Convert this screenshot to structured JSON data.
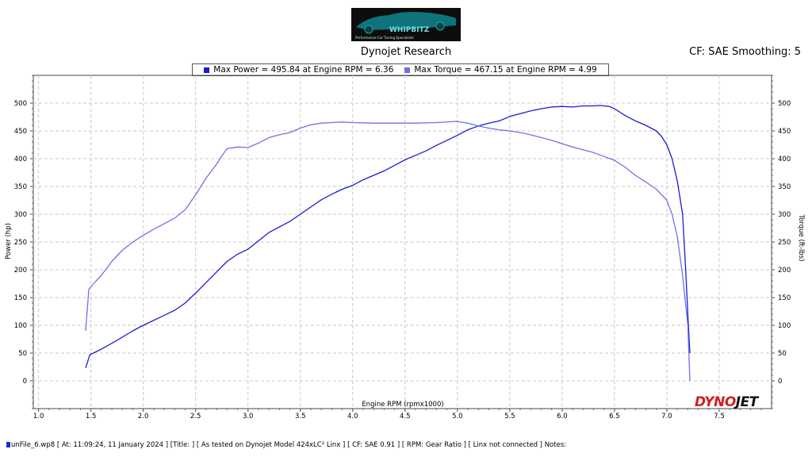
{
  "header": {
    "logo_text": "WHIPBITZ",
    "logo_subtext": "Performance Car Tuning Specialists",
    "title": "Dynojet Research",
    "cf_text": "CF: SAE Smoothing: 5"
  },
  "legend": [
    {
      "label": "Max Power = 495.84 at Engine RPM = 6.36",
      "color": "#1a1ad6"
    },
    {
      "label": "Max Torque = 467.15 at Engine RPM = 4.99",
      "color": "#6f72e6"
    }
  ],
  "brand": {
    "part1": "DYNO",
    "part2": "JET"
  },
  "footer": "unFile_6.wp8 [ At: 11:09:24, 11 January 2024 ] [Title: ]  [ As tested on Dynojet Model 424xLC² Linx ] [ CF: SAE 0.91 ] [ RPM: Gear Ratio ] [ Linx not connected ] Notes:",
  "chart_data": {
    "type": "line",
    "xlabel": "Engine RPM (rpmx1000)",
    "ylabel": "Power (hp)",
    "y2label": "Torque (ft-lbs)",
    "xlim": [
      0.95,
      8.0
    ],
    "ylim": [
      -50,
      550
    ],
    "x_ticks": [
      1.0,
      1.5,
      2.0,
      2.5,
      3.0,
      3.5,
      4.0,
      4.5,
      5.0,
      5.5,
      6.0,
      6.5,
      7.0,
      7.5
    ],
    "y_ticks": [
      0,
      50,
      100,
      150,
      200,
      250,
      300,
      350,
      400,
      450,
      500
    ],
    "grid": true,
    "series": [
      {
        "name": "Power",
        "color": "#1a1ad6",
        "points": [
          [
            1.45,
            23
          ],
          [
            1.49,
            47
          ],
          [
            1.6,
            57
          ],
          [
            1.75,
            73
          ],
          [
            1.9,
            90
          ],
          [
            2.0,
            100
          ],
          [
            2.2,
            118
          ],
          [
            2.3,
            127
          ],
          [
            2.4,
            140
          ],
          [
            2.5,
            158
          ],
          [
            2.6,
            177
          ],
          [
            2.7,
            196
          ],
          [
            2.8,
            215
          ],
          [
            2.9,
            228
          ],
          [
            3.0,
            237
          ],
          [
            3.1,
            252
          ],
          [
            3.2,
            267
          ],
          [
            3.4,
            287
          ],
          [
            3.5,
            300
          ],
          [
            3.6,
            313
          ],
          [
            3.7,
            326
          ],
          [
            3.8,
            336
          ],
          [
            3.9,
            345
          ],
          [
            4.0,
            352
          ],
          [
            4.1,
            362
          ],
          [
            4.2,
            370
          ],
          [
            4.3,
            378
          ],
          [
            4.4,
            388
          ],
          [
            4.5,
            398
          ],
          [
            4.6,
            406
          ],
          [
            4.7,
            414
          ],
          [
            4.8,
            424
          ],
          [
            4.9,
            433
          ],
          [
            5.0,
            442
          ],
          [
            5.1,
            452
          ],
          [
            5.2,
            459
          ],
          [
            5.3,
            464
          ],
          [
            5.4,
            468
          ],
          [
            5.5,
            476
          ],
          [
            5.6,
            481
          ],
          [
            5.7,
            486
          ],
          [
            5.8,
            490
          ],
          [
            5.9,
            493
          ],
          [
            6.0,
            494
          ],
          [
            6.1,
            493
          ],
          [
            6.2,
            495
          ],
          [
            6.3,
            495
          ],
          [
            6.36,
            495.84
          ],
          [
            6.45,
            494
          ],
          [
            6.5,
            490
          ],
          [
            6.6,
            478
          ],
          [
            6.7,
            468
          ],
          [
            6.8,
            460
          ],
          [
            6.9,
            450
          ],
          [
            6.95,
            440
          ],
          [
            7.0,
            425
          ],
          [
            7.05,
            400
          ],
          [
            7.1,
            360
          ],
          [
            7.15,
            300
          ],
          [
            7.18,
            200
          ],
          [
            7.2,
            120
          ],
          [
            7.22,
            50
          ]
        ]
      },
      {
        "name": "Torque",
        "color": "#6f72e6",
        "points": [
          [
            1.45,
            90
          ],
          [
            1.48,
            165
          ],
          [
            1.55,
            180
          ],
          [
            1.6,
            190
          ],
          [
            1.7,
            215
          ],
          [
            1.8,
            235
          ],
          [
            1.9,
            250
          ],
          [
            2.0,
            262
          ],
          [
            2.1,
            273
          ],
          [
            2.2,
            283
          ],
          [
            2.3,
            293
          ],
          [
            2.4,
            308
          ],
          [
            2.5,
            335
          ],
          [
            2.6,
            365
          ],
          [
            2.7,
            390
          ],
          [
            2.75,
            405
          ],
          [
            2.8,
            418
          ],
          [
            2.9,
            421
          ],
          [
            3.0,
            420
          ],
          [
            3.1,
            428
          ],
          [
            3.2,
            438
          ],
          [
            3.3,
            443
          ],
          [
            3.4,
            447
          ],
          [
            3.5,
            455
          ],
          [
            3.6,
            461
          ],
          [
            3.7,
            464
          ],
          [
            3.8,
            465
          ],
          [
            3.9,
            466
          ],
          [
            4.0,
            465
          ],
          [
            4.2,
            464
          ],
          [
            4.4,
            464
          ],
          [
            4.6,
            464
          ],
          [
            4.8,
            465
          ],
          [
            4.99,
            467.15
          ],
          [
            5.1,
            464
          ],
          [
            5.2,
            459
          ],
          [
            5.3,
            455
          ],
          [
            5.4,
            452
          ],
          [
            5.5,
            450
          ],
          [
            5.6,
            447
          ],
          [
            5.7,
            443
          ],
          [
            5.8,
            438
          ],
          [
            5.9,
            433
          ],
          [
            6.0,
            427
          ],
          [
            6.1,
            421
          ],
          [
            6.2,
            416
          ],
          [
            6.3,
            411
          ],
          [
            6.4,
            404
          ],
          [
            6.5,
            397
          ],
          [
            6.6,
            385
          ],
          [
            6.7,
            370
          ],
          [
            6.8,
            358
          ],
          [
            6.9,
            345
          ],
          [
            7.0,
            325
          ],
          [
            7.05,
            300
          ],
          [
            7.1,
            260
          ],
          [
            7.15,
            190
          ],
          [
            7.2,
            100
          ],
          [
            7.22,
            0
          ]
        ]
      }
    ]
  }
}
